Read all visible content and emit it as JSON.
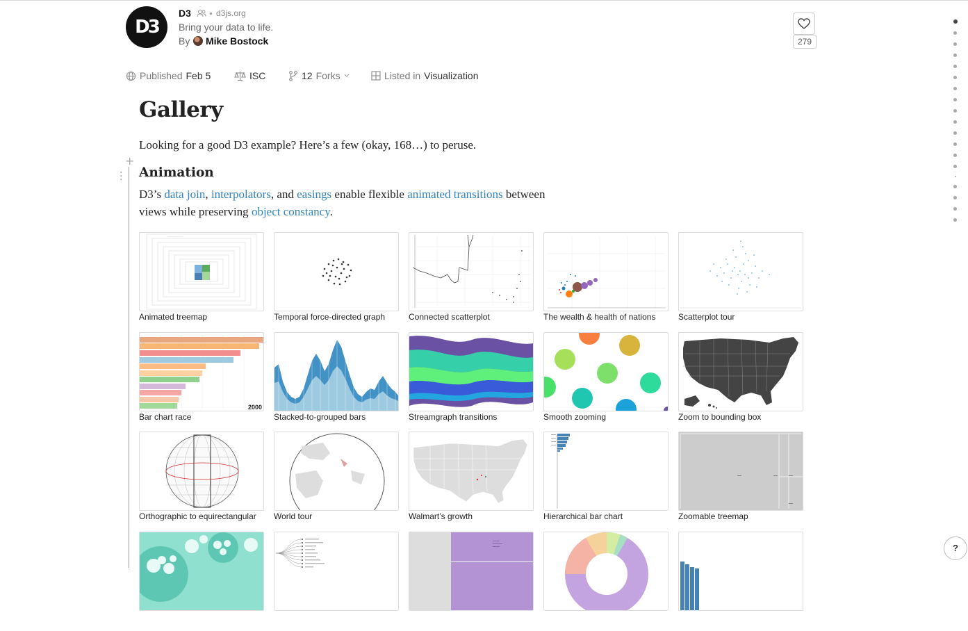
{
  "notebook": {
    "logo_text": "D3",
    "title": "D3",
    "domain": "d3js.org",
    "description": "Bring your data to life.",
    "by_label": "By",
    "author": "Mike Bostock",
    "likes": "279"
  },
  "meta": {
    "published_label": "Published",
    "published_date": "Feb 5",
    "license": "ISC",
    "forks_count": "12",
    "forks_label": "Forks",
    "listed_label": "Listed in",
    "listed_collection": "Visualization"
  },
  "content": {
    "title": "Gallery",
    "intro": "Looking for a good D3 example? Here’s a few (okay, 168…) to peruse.",
    "section_title": "Animation",
    "para": {
      "t1": "D3’s ",
      "l1": "data join",
      "t2": ", ",
      "l2": "interpolators",
      "t3": ", and ",
      "l3": "easings",
      "t4": " enable flexible ",
      "l4": "animated transitions",
      "t5": " between views while preserving ",
      "l5": "object constancy",
      "t6": "."
    }
  },
  "gallery": [
    {
      "caption": "Animated treemap"
    },
    {
      "caption": "Temporal force-directed graph"
    },
    {
      "caption": "Connected scatterplot"
    },
    {
      "caption": "The wealth & health of nations"
    },
    {
      "caption": "Scatterplot tour"
    },
    {
      "caption": "Bar chart race",
      "badge": "2000"
    },
    {
      "caption": "Stacked-to-grouped bars"
    },
    {
      "caption": "Streamgraph transitions"
    },
    {
      "caption": "Smooth zooming"
    },
    {
      "caption": "Zoom to bounding box"
    },
    {
      "caption": "Orthographic to equirectangular"
    },
    {
      "caption": "World tour"
    },
    {
      "caption": "Walmart’s growth"
    },
    {
      "caption": "Hierarchical bar chart"
    },
    {
      "caption": "Zoomable treemap"
    },
    {
      "caption": ""
    },
    {
      "caption": ""
    },
    {
      "caption": ""
    },
    {
      "caption": ""
    },
    {
      "caption": ""
    }
  ],
  "help_label": "?",
  "colors": {
    "link": "#3182bd",
    "logo_bg": "#111111"
  }
}
